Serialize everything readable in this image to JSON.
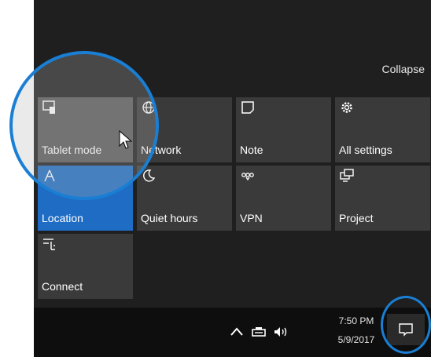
{
  "panel": {
    "collapse_label": "Collapse",
    "tiles": [
      {
        "label": "Tablet mode",
        "icon": "tablet-mode-icon",
        "state": "hover"
      },
      {
        "label": "Network",
        "icon": "network-globe-icon",
        "state": "off"
      },
      {
        "label": "Note",
        "icon": "note-icon",
        "state": "off"
      },
      {
        "label": "All settings",
        "icon": "gear-icon",
        "state": "off"
      },
      {
        "label": "Location",
        "icon": "location-icon",
        "state": "on"
      },
      {
        "label": "Quiet hours",
        "icon": "moon-icon",
        "state": "off"
      },
      {
        "label": "VPN",
        "icon": "vpn-icon",
        "state": "off"
      },
      {
        "label": "Project",
        "icon": "project-icon",
        "state": "off"
      },
      {
        "label": "Connect",
        "icon": "connect-icon",
        "state": "off"
      }
    ]
  },
  "taskbar": {
    "time": "7:50 PM",
    "date": "5/9/2017",
    "tray_icons": [
      "chevron-up-icon",
      "network-icon",
      "volume-icon"
    ],
    "action_center_icon": "action-center-icon"
  },
  "colors": {
    "accent": "#1e6cc4",
    "highlight_circle": "#1a7fd4",
    "tile_bg": "#3a3a3a",
    "panel_bg": "#1f1f1f"
  }
}
